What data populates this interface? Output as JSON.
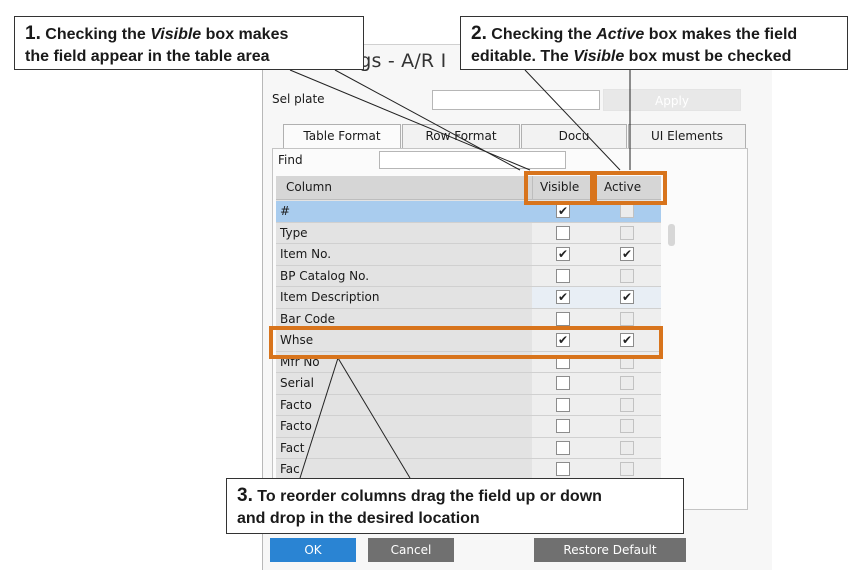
{
  "window": {
    "title": "ngs - A/R I"
  },
  "template": {
    "label": "Sel         plate",
    "apply_label": "Apply"
  },
  "tabs": [
    {
      "label": "Table Format"
    },
    {
      "label": "Row Format"
    },
    {
      "label": "Docu"
    },
    {
      "label": "UI Elements"
    }
  ],
  "find": {
    "label": "Find"
  },
  "grid": {
    "headers": {
      "column": "Column",
      "visible": "Visible",
      "active": "Active"
    },
    "rows": [
      {
        "name": "#",
        "visible": true,
        "active": false,
        "active_enabled": false
      },
      {
        "name": "Type",
        "visible": false,
        "active": false,
        "active_enabled": false
      },
      {
        "name": "Item No.",
        "visible": true,
        "active": true,
        "active_enabled": true
      },
      {
        "name": "BP Catalog No.",
        "visible": false,
        "active": false,
        "active_enabled": false
      },
      {
        "name": "Item Description",
        "visible": true,
        "active": true,
        "active_enabled": true
      },
      {
        "name": "Bar Code",
        "visible": false,
        "active": false,
        "active_enabled": false
      },
      {
        "name": "Whse",
        "visible": true,
        "active": true,
        "active_enabled": true
      },
      {
        "name": "Mfr No",
        "visible": false,
        "active": false,
        "active_enabled": false
      },
      {
        "name": "Serial",
        "visible": false,
        "active": false,
        "active_enabled": false
      },
      {
        "name": "Facto",
        "visible": false,
        "active": false,
        "active_enabled": false
      },
      {
        "name": "Facto",
        "visible": false,
        "active": false,
        "active_enabled": false
      },
      {
        "name": "Fact",
        "visible": false,
        "active": false,
        "active_enabled": false
      },
      {
        "name": "Fac",
        "visible": false,
        "active": false,
        "active_enabled": false
      }
    ]
  },
  "footer": {
    "ok_label": "OK",
    "cancel_label": "Cancel",
    "restore_label": "Restore Default"
  },
  "callouts": {
    "c1": {
      "num": "1.",
      "pre": " Checking the ",
      "em": "Visible",
      "post": " box makes",
      "line2": "the field appear in the table area"
    },
    "c2": {
      "num": "2.",
      "pre": " Checking the ",
      "em": "Active",
      "post": " box makes the field",
      "line2_pre": "editable.  The ",
      "line2_em": "Visible",
      "line2_post": " box must be checked"
    },
    "c3": {
      "num": "3.",
      "line1": " To reorder columns drag the field up or down",
      "line2": "and drop in the desired location"
    }
  },
  "colors": {
    "highlight": "#d8741c",
    "selected_row": "#a9ccee",
    "ok_button": "#2a84d3",
    "gray_button": "#707070"
  }
}
